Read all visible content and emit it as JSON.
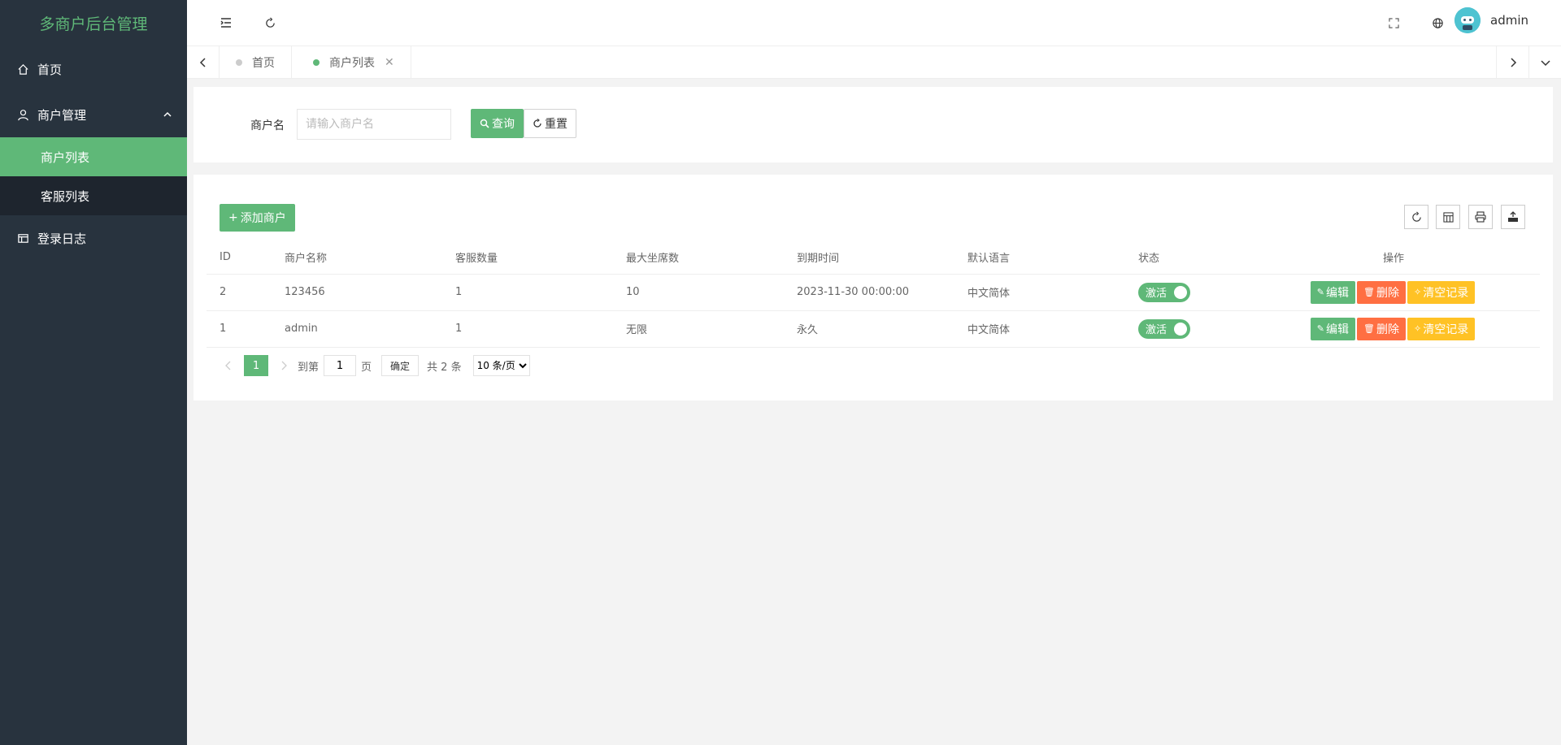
{
  "app": {
    "title": "多商户后台管理"
  },
  "sidebar": {
    "items": [
      {
        "label": "首页",
        "icon": "home-icon"
      },
      {
        "label": "商户管理",
        "icon": "user-icon",
        "expanded": true,
        "children": [
          {
            "label": "商户列表",
            "active": true
          },
          {
            "label": "客服列表",
            "active": false
          }
        ]
      },
      {
        "label": "登录日志",
        "icon": "log-icon"
      }
    ]
  },
  "header": {
    "username": "admin"
  },
  "tabs": [
    {
      "label": "首页",
      "active": false
    },
    {
      "label": "商户列表",
      "active": true,
      "close": "✕"
    }
  ],
  "search": {
    "label": "商户名",
    "placeholder": "请输入商户名",
    "search_btn": "查询",
    "reset_btn": "重置"
  },
  "table": {
    "add_btn": "添加商户",
    "columns": [
      "ID",
      "商户名称",
      "客服数量",
      "最大坐席数",
      "到期时间",
      "默认语言",
      "状态",
      "操作"
    ],
    "rows": [
      {
        "id": "2",
        "name": "123456",
        "cs_count": "1",
        "max_seats": "10",
        "expire": "2023-11-30 00:00:00",
        "lang": "中文简体",
        "status": "激活"
      },
      {
        "id": "1",
        "name": "admin",
        "cs_count": "1",
        "max_seats": "无限",
        "expire": "永久",
        "lang": "中文简体",
        "status": "激活"
      }
    ],
    "actions": {
      "edit": "编辑",
      "delete": "删除",
      "clear": "清空记录"
    }
  },
  "pagination": {
    "current": "1",
    "goto_label": "到第",
    "goto_value": "1",
    "page_label": "页",
    "ok_btn": "确定",
    "total": "共 2 条",
    "page_size": "10 条/页"
  },
  "colors": {
    "sidebar_bg": "#28333e",
    "accent": "#5fb878",
    "danger": "#ff5722",
    "warn": "#ffb800"
  }
}
